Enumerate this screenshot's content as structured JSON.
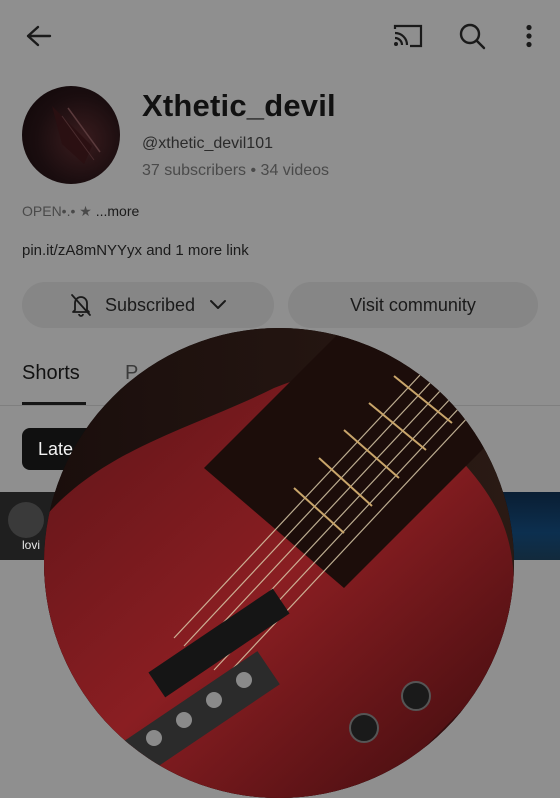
{
  "topbar": {
    "back_icon": "arrow-left-icon",
    "cast_icon": "cast-icon",
    "search_icon": "search-icon",
    "more_icon": "more-vertical-icon"
  },
  "channel": {
    "name": "Xthetic_devil",
    "handle": "@xthetic_devil101",
    "stats": "37 subscribers • 34 videos",
    "description": "OPEN•.• ★ ",
    "description_more": "...more",
    "links": "pin.it/zA8mNYYyx and 1 more link"
  },
  "actions": {
    "subscribed_label": "Subscribed",
    "visit_label": "Visit community"
  },
  "tabs": {
    "first": "Shorts",
    "second": "P"
  },
  "filter": {
    "chip_label": "Late"
  },
  "thumbnail": {
    "label": "lovi"
  }
}
